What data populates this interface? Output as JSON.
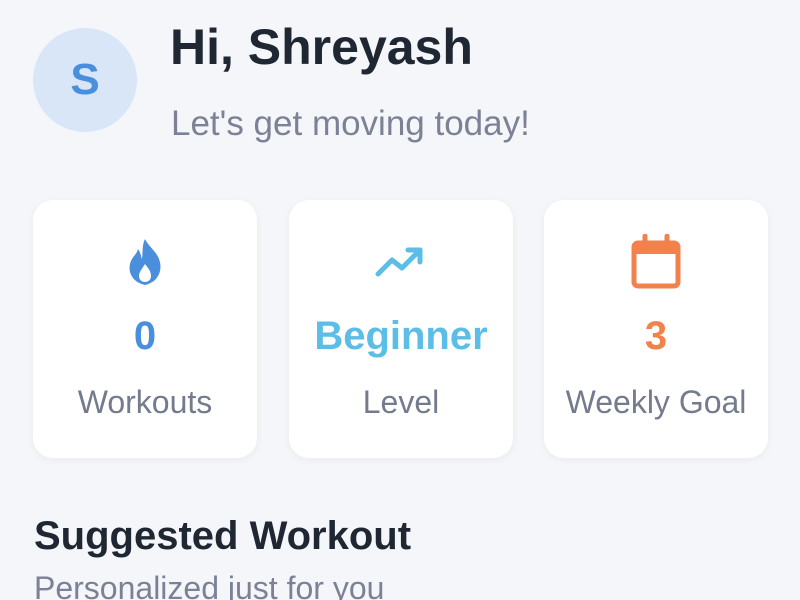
{
  "user": {
    "avatar_initial": "S",
    "greeting": "Hi, Shreyash",
    "subtitle": "Let's get moving today!"
  },
  "stats": [
    {
      "icon": "flame-icon",
      "value": "0",
      "label": "Workouts",
      "color": "#4a8fdb"
    },
    {
      "icon": "trending-up-icon",
      "value": "Beginner",
      "label": "Level",
      "color": "#5cbde6"
    },
    {
      "icon": "calendar-icon",
      "value": "3",
      "label": "Weekly Goal",
      "color": "#f2814c"
    }
  ],
  "suggested": {
    "title": "Suggested Workout",
    "subtitle": "Personalized just for you"
  },
  "colors": {
    "background": "#f5f6f9",
    "avatar_bg": "#d8e6f7",
    "avatar_text": "#4a8fdb",
    "heading": "#1f2733",
    "muted": "#7b8296"
  }
}
